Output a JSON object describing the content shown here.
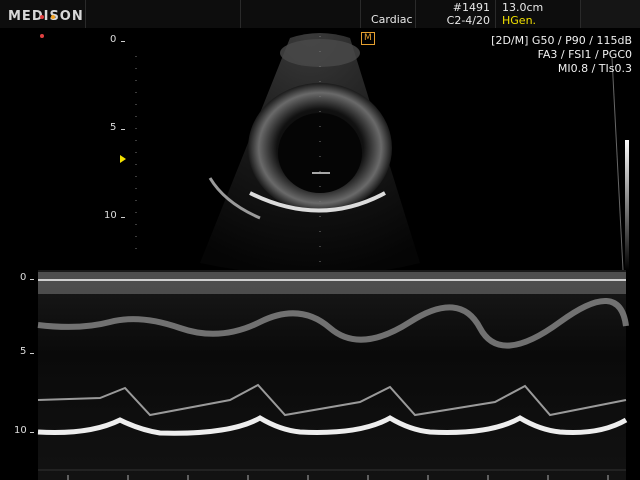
{
  "header": {
    "brand": "MEDISON",
    "brand_dot_colors": [
      "#e04040",
      "#f0a020",
      "#e04040"
    ],
    "image_number": "#1491",
    "depth": "13.0cm",
    "application": "Cardiac",
    "probe": "C2-4/20",
    "harmonic_mode": "HGen."
  },
  "overlay": {
    "mode_line": "[2D/M] G50 / P90 / 115dB",
    "line2": "FA3 / FSI1 / PGC0",
    "line3": "MI0.8 / TIs0.3",
    "m_line_badge": "M"
  },
  "bmode_scale": {
    "labels": [
      "0",
      "5",
      "10"
    ]
  },
  "mmode_scale": {
    "labels": [
      "0",
      "5",
      "10"
    ]
  },
  "colors": {
    "accent_yellow": "#f2e000",
    "header_bg": "#0d0d0d",
    "badge_orange": "#e5a030"
  }
}
